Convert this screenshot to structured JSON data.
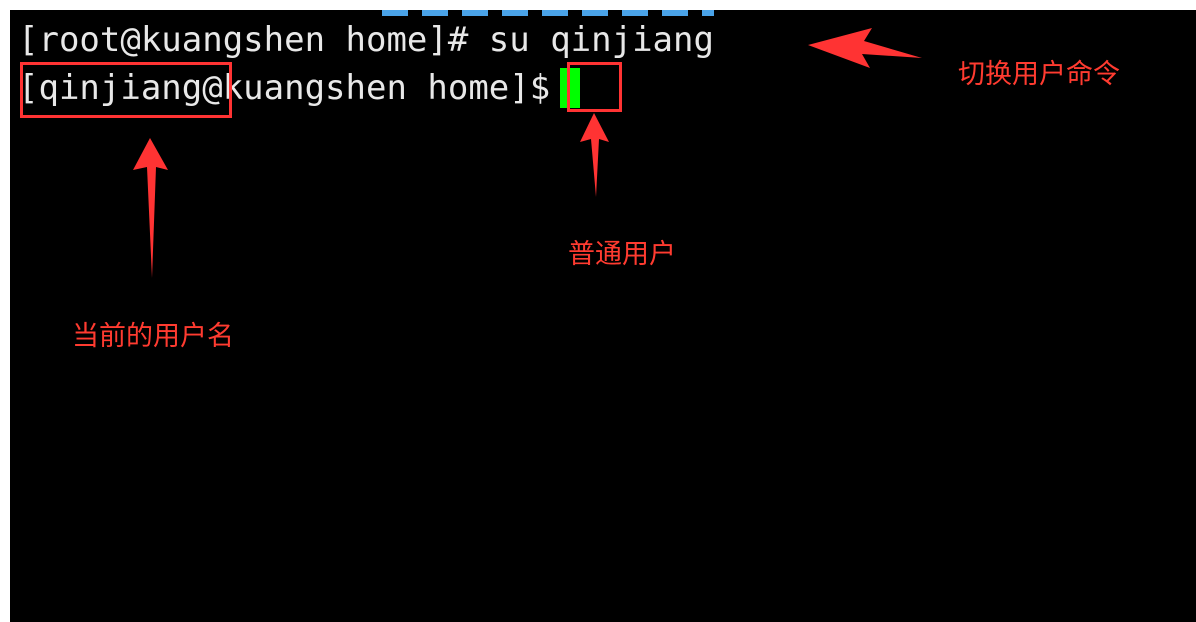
{
  "terminal": {
    "line1": {
      "text": "[root@kuangshen home]# su qinjiang"
    },
    "line2": {
      "username_part": "[qinjiang",
      "host_part": "@kuangshen home",
      "prompt_symbol": "]$",
      "cursor_color": "#00ff00"
    }
  },
  "annotations": {
    "switch_user_command": "切换用户命令",
    "normal_user": "普通用户",
    "current_username": "当前的用户名",
    "color": "#ff3333"
  }
}
